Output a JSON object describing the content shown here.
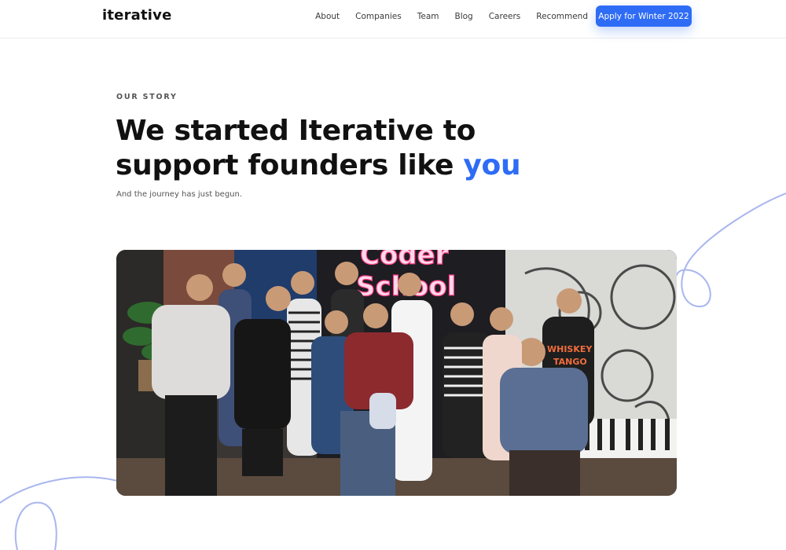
{
  "header": {
    "logo": "iterative",
    "nav": [
      "About",
      "Companies",
      "Team",
      "Blog",
      "Careers",
      "Recommend"
    ],
    "cta_label": "Apply for Winter 2022"
  },
  "hero": {
    "eyebrow": "OUR STORY",
    "headline_line1": "We started Iterative to",
    "headline_line2": "support founders like",
    "headline_accent": "you",
    "subline": "And the journey has just begun."
  },
  "photo": {
    "sign_line1": "Coder",
    "sign_line2": "School",
    "shirt_text_1": "WHISKEY",
    "shirt_text_2": "TANGO"
  },
  "colors": {
    "accent": "#2e6cf6",
    "deco_line": "#a9b6ef"
  }
}
